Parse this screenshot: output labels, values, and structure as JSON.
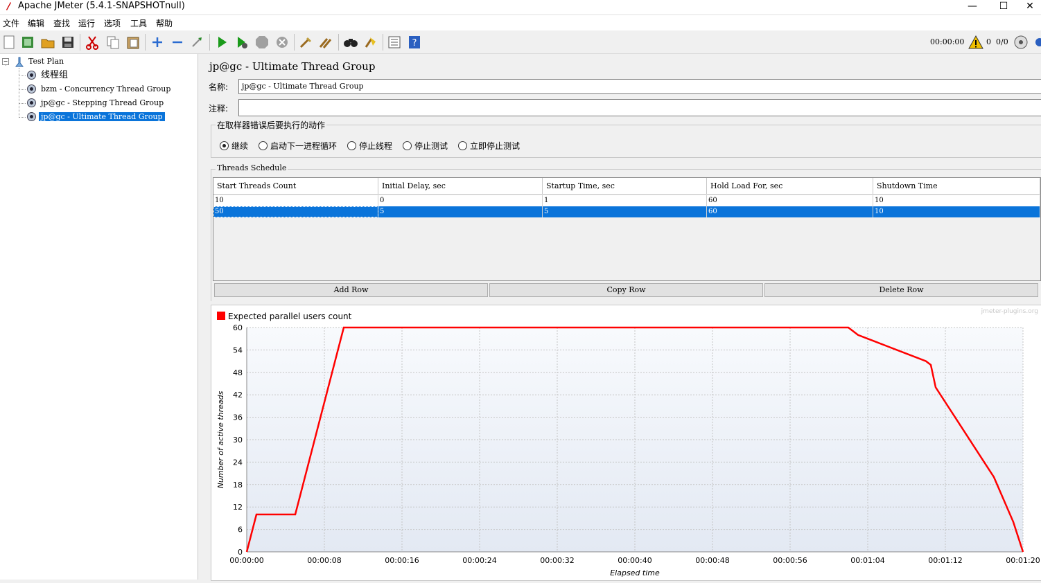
{
  "window": {
    "title": "Apache JMeter (5.4.1-SNAPSHOTnull)",
    "minimize": "—",
    "maximize": "☐",
    "close": "✕"
  },
  "menu": [
    "文件",
    "编辑",
    "查找",
    "运行",
    "选项",
    "工具",
    "帮助"
  ],
  "toolbar": {
    "timer": "00:00:00",
    "warn_count": "0",
    "threads": "0/0",
    "icons": [
      "new-icon",
      "templates-icon",
      "open-icon",
      "save-icon",
      "cut-icon",
      "copy-icon",
      "paste-icon",
      "expand-icon",
      "collapse-icon",
      "toggle-icon",
      "start-icon",
      "start-no-pause-icon",
      "stop-icon",
      "shutdown-icon",
      "clear-icon",
      "clear-all-icon",
      "search-icon",
      "reset-search-icon",
      "function-helper-icon",
      "help-icon"
    ]
  },
  "tree": {
    "root": "Test Plan",
    "children": [
      "线程组",
      "bzm - Concurrency Thread Group",
      "jp@gc - Stepping Thread Group",
      "jp@gc - Ultimate Thread Group"
    ],
    "selected_index": 3
  },
  "panel": {
    "heading": "jp@gc - Ultimate Thread Group",
    "name_label": "名称:",
    "name_value": "jp@gc - Ultimate Thread Group",
    "comment_label": "注释:",
    "comment_value": "",
    "error_group_title": "在取样器错误后要执行的动作",
    "error_options": [
      "继续",
      "启动下一进程循环",
      "停止线程",
      "停止测试",
      "立即停止测试"
    ],
    "error_selected": 0,
    "schedule_title": "Threads Schedule",
    "columns": [
      "Start Threads Count",
      "Initial Delay, sec",
      "Startup Time, sec",
      "Hold Load For, sec",
      "Shutdown Time"
    ],
    "rows": [
      [
        "10",
        "0",
        "1",
        "60",
        "10"
      ],
      [
        "50",
        "5",
        "5",
        "60",
        "10"
      ]
    ],
    "selected_row": 1,
    "buttons": {
      "add": "Add Row",
      "copy": "Copy Row",
      "delete": "Delete Row"
    }
  },
  "chart_data": {
    "type": "line",
    "title": "",
    "watermark": "jmeter-plugins.org",
    "xlabel": "Elapsed time",
    "ylabel": "Number of active threads",
    "legend": "top-left",
    "grid": true,
    "x_unit": "seconds",
    "xlim": [
      0,
      80
    ],
    "ylim": [
      0,
      60
    ],
    "x_ticks": [
      "00:00:00",
      "00:00:08",
      "00:00:16",
      "00:00:24",
      "00:00:32",
      "00:00:40",
      "00:00:48",
      "00:00:56",
      "00:01:04",
      "00:01:12",
      "00:01:20"
    ],
    "y_ticks": [
      "0",
      "6",
      "12",
      "18",
      "24",
      "30",
      "36",
      "42",
      "48",
      "54",
      "60"
    ],
    "series": [
      {
        "name": "Expected parallel users count",
        "color": "#ff0000",
        "points": [
          [
            0,
            0
          ],
          [
            1,
            10
          ],
          [
            5,
            10
          ],
          [
            10,
            60
          ],
          [
            62,
            60
          ],
          [
            62.5,
            59
          ],
          [
            63,
            58
          ],
          [
            64,
            57
          ],
          [
            65,
            56
          ],
          [
            66,
            55
          ],
          [
            67,
            54
          ],
          [
            68,
            53
          ],
          [
            69,
            52
          ],
          [
            70,
            51
          ],
          [
            70.5,
            50
          ],
          [
            71,
            44
          ],
          [
            72,
            40
          ],
          [
            73,
            36
          ],
          [
            74,
            32
          ],
          [
            75,
            28
          ],
          [
            76,
            24
          ],
          [
            77,
            20
          ],
          [
            78,
            14
          ],
          [
            79,
            8
          ],
          [
            80,
            0
          ]
        ]
      }
    ]
  }
}
